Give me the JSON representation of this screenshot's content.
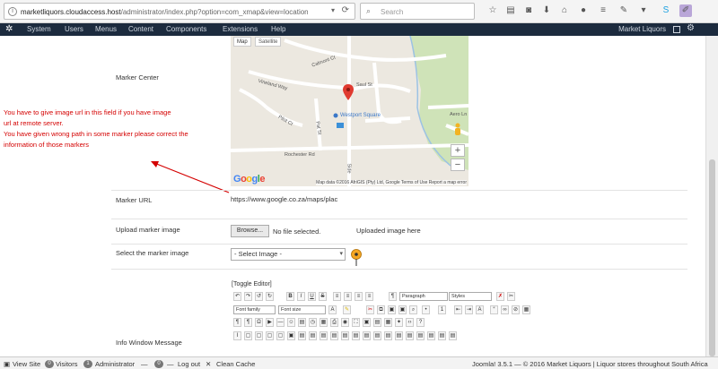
{
  "browser": {
    "url_host": "marketliquors.cloudaccess.host",
    "url_path": "/administrator/index.php?option=com_xmap&view=location&",
    "search_placeholder": "Search",
    "icons": [
      "star-icon",
      "reading-list-icon",
      "pocket-icon",
      "download-icon",
      "home-icon",
      "chat-icon",
      "menu-icon",
      "paint-icon",
      "skype-icon",
      "pencil-icon"
    ]
  },
  "admin_menu": {
    "items": [
      "System",
      "Users",
      "Menus",
      "Content",
      "Components",
      "Extensions",
      "Help"
    ],
    "site_name": "Market Liquors"
  },
  "form": {
    "marker_center_label": "Marker Center",
    "map_tab_map": "Map",
    "map_tab_satellite": "Satellite",
    "map_roads": [
      "Calmont Ct",
      "Vineland Way",
      "Saul St",
      "Pat St",
      "Rochester Rd",
      "Pilot Ct",
      "Aero Ln",
      "Side",
      "Westport Square"
    ],
    "map_footer": "Map data ©2016 AfriGIS (Pty) Ltd, Google   Terms of Use   Report a map error",
    "google": "Google",
    "marker_url_label": "Marker URL",
    "marker_url_value": "https://www.google.co.za/maps/plac",
    "upload_label": "Upload marker image",
    "browse_label": "Browse...",
    "no_file": "No file selected.",
    "uploaded_label": "Uploaded image here",
    "select_label": "Select the marker image",
    "select_value": "- Select Image -",
    "info_label": "Info Window Message",
    "toggle_editor": "[Toggle Editor]",
    "editor_paragraph": "Paragraph",
    "editor_styles": "Styles",
    "editor_font_family": "Font family",
    "editor_font_size": "Font size"
  },
  "note": {
    "lines": [
      "You have to give image url in this field if you have image",
      "url at remote server.",
      "You have given wrong path in some marker please correct the",
      "information of those markers"
    ],
    "color": "#d40000"
  },
  "statusbar": {
    "view_site": "View Site",
    "visitors_count": "0",
    "visitors": "Visitors",
    "admins_count": "1",
    "administrator": "Administrator",
    "messages_count": "0",
    "logout": "Log out",
    "clean_cache": "Clean Cache",
    "footer": "Joomla! 3.5.1 — © 2016 Market Liquors | Liquor stores throughout South Africa"
  }
}
